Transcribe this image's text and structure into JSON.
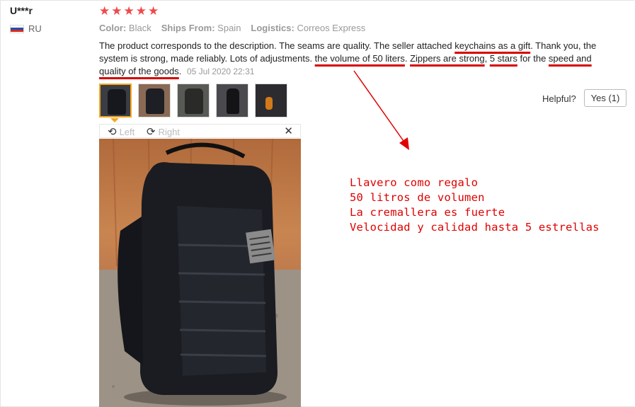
{
  "user": {
    "name": "U***r",
    "country": "RU"
  },
  "rating": {
    "stars": 5,
    "max": 5,
    "star_color": "#f04a4a"
  },
  "meta": {
    "color_label": "Color:",
    "color_value": "Black",
    "ships_label": "Ships From:",
    "ships_value": "Spain",
    "logistics_label": "Logistics:",
    "logistics_value": "Correos Express"
  },
  "review": {
    "p1": "The product corresponds to the description. The seams are quality. The seller attached ",
    "u1": "keychains as a gift",
    "p2": ". Thank you, the system is strong, made reliably. Lots of adjustments. ",
    "u2": "the volume of 50 liters",
    "p3": ". ",
    "u3": "Zippers are strong",
    "p4": ", ",
    "u4": "5 stars",
    "p5": " for the ",
    "u5": "speed and quality of the goods",
    "p6": ".",
    "date": "05 Jul 2020 22:31"
  },
  "viewer": {
    "left_label": "Left",
    "right_label": "Right",
    "close_glyph": "✕"
  },
  "helpful": {
    "label": "Helpful?",
    "yes_label": "Yes (1)"
  },
  "annotation": {
    "line1": "Llavero como regalo",
    "line2": "50 litros de volumen",
    "line3": "La cremallera es fuerte",
    "line4": "Velocidad y calidad hasta 5 estrellas",
    "color": "#e00000"
  }
}
